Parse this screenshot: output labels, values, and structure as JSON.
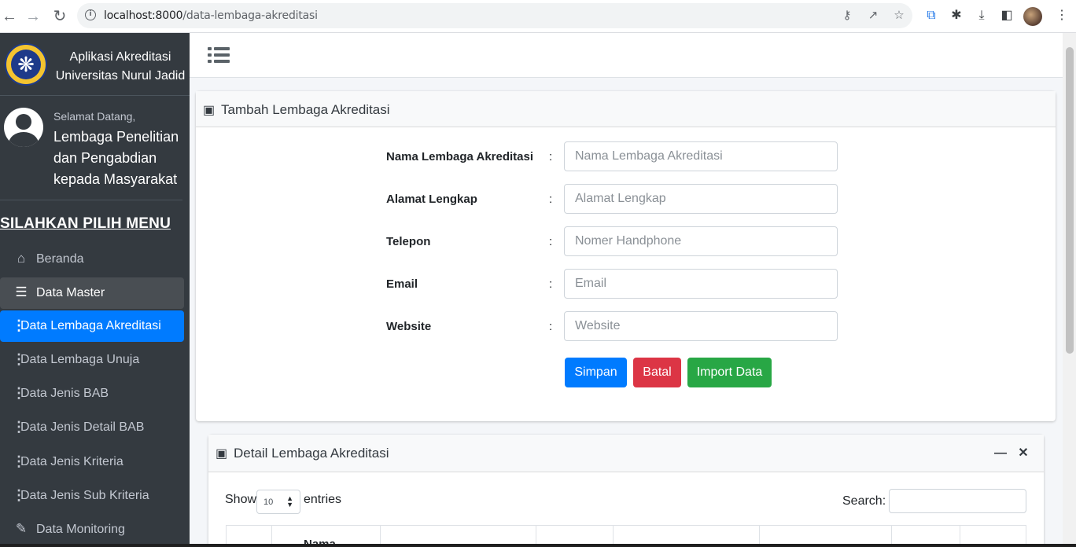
{
  "browser": {
    "url_host": "localhost:8000",
    "url_path": "/data-lembaga-akreditasi"
  },
  "brand": {
    "line1": "Aplikasi Akreditasi",
    "line2": "Universitas Nurul Jadid"
  },
  "user": {
    "welcome": "Selamat Datang,",
    "name": "Lembaga Penelitian dan Pengabdian kepada Masyarakat"
  },
  "menu": {
    "header": "SILAHKAN PILIH MENU",
    "items": [
      {
        "label": "Beranda",
        "icon": "home-icon",
        "state": "normal"
      },
      {
        "label": "Data Master",
        "icon": "server-icon",
        "state": "open"
      },
      {
        "label": "Data Lembaga Akreditasi",
        "icon": "vertical-dots-icon",
        "state": "active"
      },
      {
        "label": "Data Lembaga Unuja",
        "icon": "vertical-dots-icon",
        "state": "normal"
      },
      {
        "label": "Data Jenis BAB",
        "icon": "vertical-dots-icon",
        "state": "normal"
      },
      {
        "label": "Data Jenis Detail BAB",
        "icon": "vertical-dots-icon",
        "state": "normal"
      },
      {
        "label": "Data Jenis Kriteria",
        "icon": "vertical-dots-icon",
        "state": "normal"
      },
      {
        "label": "Data Jenis Sub Kriteria",
        "icon": "vertical-dots-icon",
        "state": "normal"
      },
      {
        "label": "Data Monitoring",
        "icon": "edit-icon",
        "state": "normal"
      }
    ]
  },
  "form_card": {
    "title": "Tambah Lembaga Akreditasi",
    "colon": ":",
    "fields": [
      {
        "label": "Nama Lembaga Akreditasi",
        "placeholder": "Nama Lembaga Akreditasi",
        "value": ""
      },
      {
        "label": "Alamat Lengkap",
        "placeholder": "Alamat Lengkap",
        "value": ""
      },
      {
        "label": "Telepon",
        "placeholder": "Nomer Handphone",
        "value": ""
      },
      {
        "label": "Email",
        "placeholder": "Email",
        "value": ""
      },
      {
        "label": "Website",
        "placeholder": "Website",
        "value": ""
      }
    ],
    "buttons": {
      "save": "Simpan",
      "cancel": "Batal",
      "import": "Import Data"
    }
  },
  "detail_card": {
    "title": "Detail Lembaga Akreditasi",
    "show_label": "Show",
    "entries_value": "10",
    "entries_label": "entries",
    "search_label": "Search:",
    "search_value": "",
    "partial_column_header": "Nama"
  },
  "colors": {
    "sidebar_bg": "#343a40",
    "active_blue": "#007bff",
    "danger_red": "#dc3545",
    "success_green": "#28a745"
  }
}
